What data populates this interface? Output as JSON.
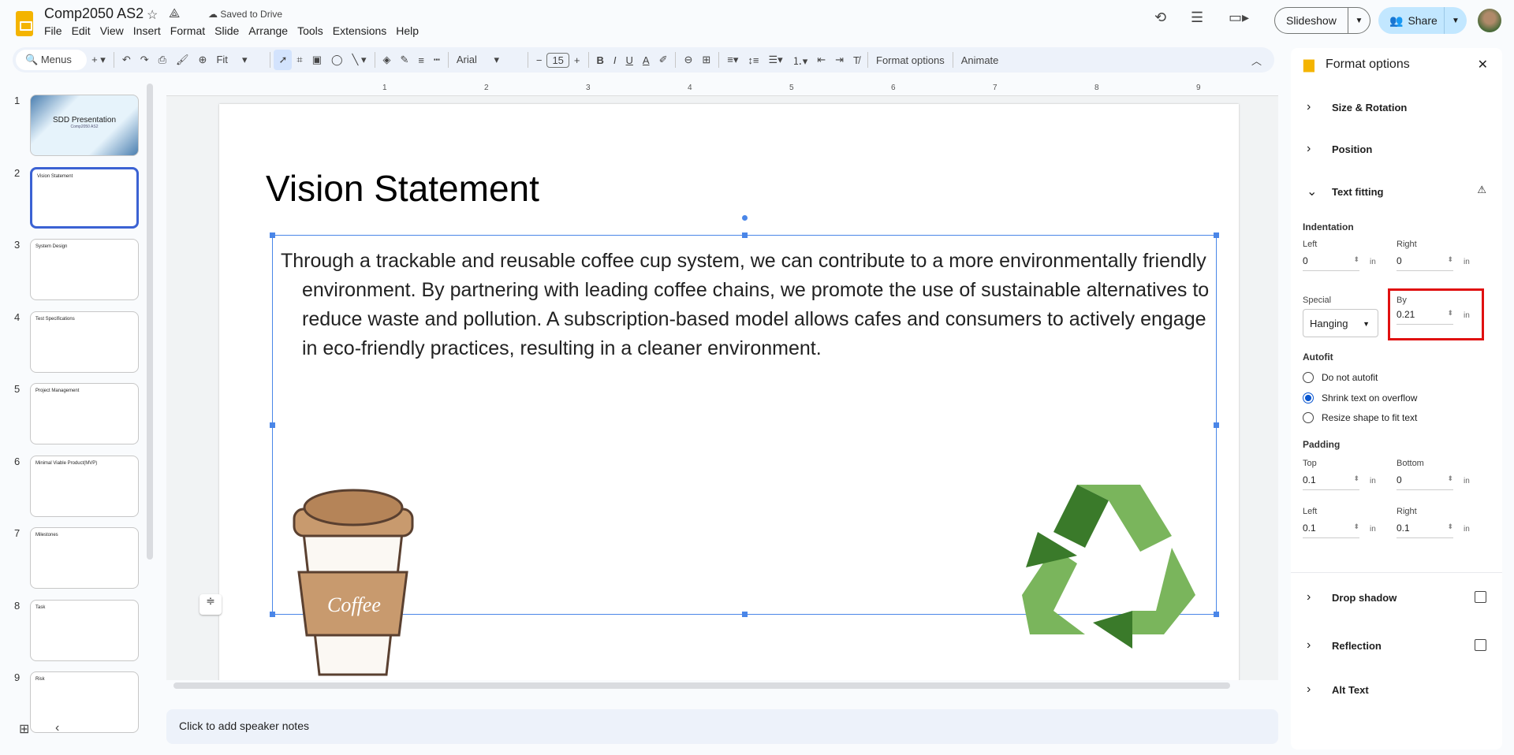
{
  "doc": {
    "title": "Comp2050 AS2",
    "saved": "Saved to Drive"
  },
  "menu": [
    "File",
    "Edit",
    "View",
    "Insert",
    "Format",
    "Slide",
    "Arrange",
    "Tools",
    "Extensions",
    "Help"
  ],
  "header": {
    "slideshow": "Slideshow",
    "share": "Share"
  },
  "toolbar": {
    "search": "Menus",
    "zoom": "Fit",
    "font": "Arial",
    "font_size": "15",
    "format_options": "Format options",
    "animate": "Animate"
  },
  "slides": [
    {
      "num": "1",
      "title": "SDD Presentation",
      "subtitle": "Comp2050 AS2"
    },
    {
      "num": "2",
      "title": "Vision Statement"
    },
    {
      "num": "3",
      "title": "System Design"
    },
    {
      "num": "4",
      "title": "Test Specifications"
    },
    {
      "num": "5",
      "title": "Project Management"
    },
    {
      "num": "6",
      "title": "Minimal Viable Product(MVP)"
    },
    {
      "num": "7",
      "title": "Milestones"
    },
    {
      "num": "8",
      "title": "Task"
    },
    {
      "num": "9",
      "title": "Risk"
    }
  ],
  "current_slide": {
    "title": "Vision Statement",
    "body": "Through a trackable and reusable coffee cup system, we can contribute to a more environmentally friendly environment. By partnering with leading coffee chains, we promote the use of sustainable alternatives to reduce waste and pollution. A subscription-based model allows cafes and consumers to actively engage in eco-friendly practices, resulting in a cleaner environment.",
    "cup_label": "Coffee"
  },
  "ruler": [
    "1",
    "2",
    "3",
    "4",
    "5",
    "6",
    "7",
    "8",
    "9"
  ],
  "notes_placeholder": "Click to add speaker notes",
  "panel": {
    "title": "Format options",
    "size_rotation": "Size & Rotation",
    "position": "Position",
    "text_fitting": "Text fitting",
    "indentation": "Indentation",
    "left": "Left",
    "right": "Right",
    "left_value": "0",
    "right_value": "0",
    "unit": "in",
    "special": "Special",
    "special_value": "Hanging",
    "by": "By",
    "by_value": "0.21",
    "autofit": "Autofit",
    "autofit_options": [
      "Do not autofit",
      "Shrink text on overflow",
      "Resize shape to fit text"
    ],
    "autofit_selected": 1,
    "padding": "Padding",
    "top": "Top",
    "bottom": "Bottom",
    "top_value": "0.1",
    "bottom_value": "0",
    "pad_left_value": "0.1",
    "pad_right_value": "0.1",
    "drop_shadow": "Drop shadow",
    "reflection": "Reflection",
    "alt_text": "Alt Text"
  },
  "colors": {
    "accent": "#0b57d0",
    "selection": "#4a86e8",
    "highlight_box": "#e01010",
    "share_bg": "#c2e7ff"
  }
}
